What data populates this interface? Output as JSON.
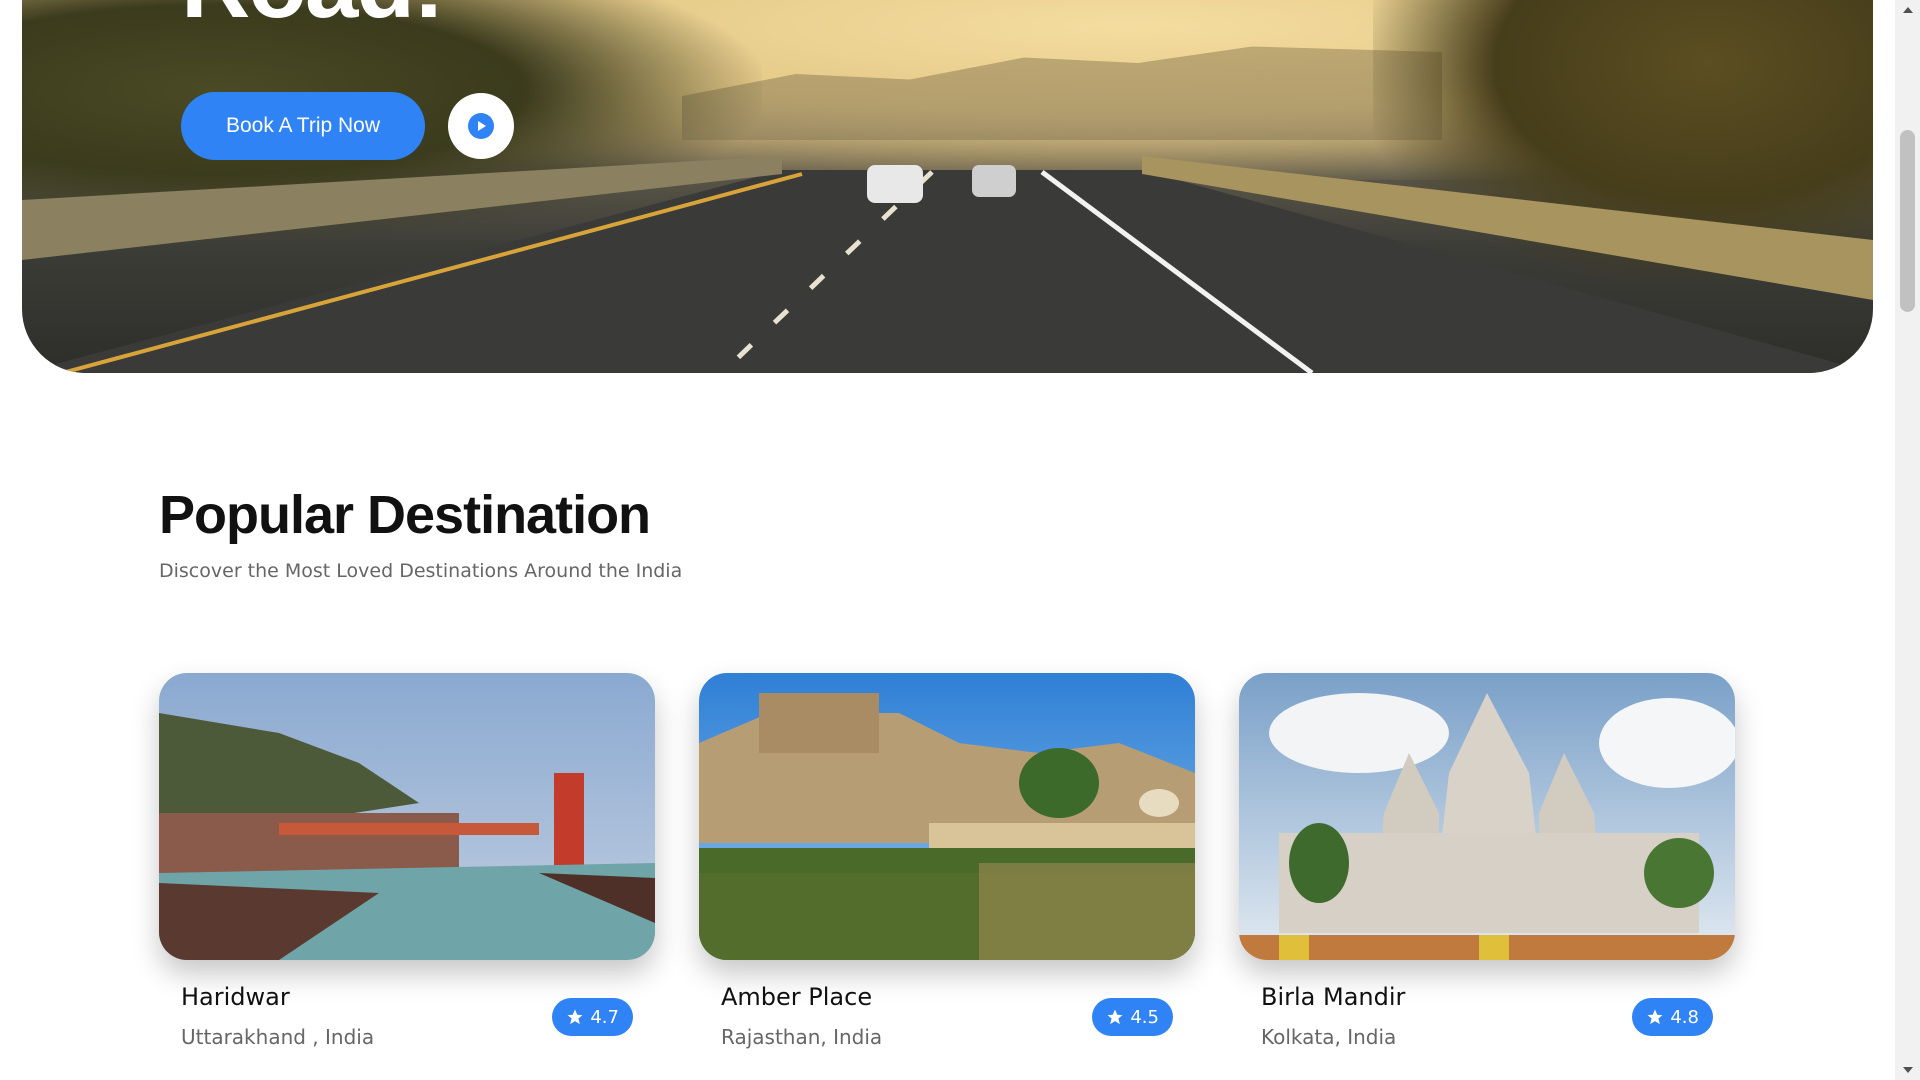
{
  "hero": {
    "title": "Road!",
    "book_button": "Book A Trip Now",
    "play_button_icon": "play-icon"
  },
  "section": {
    "title": "Popular Destination",
    "subtitle": "Discover the Most Loved Destinations Around the India"
  },
  "cards": [
    {
      "name": "Haridwar",
      "location": "Uttarakhand , India",
      "rating": "4.7"
    },
    {
      "name": "Amber Place",
      "location": "Rajasthan, India",
      "rating": "4.5"
    },
    {
      "name": "Birla Mandir",
      "location": "Kolkata, India",
      "rating": "4.8"
    }
  ],
  "colors": {
    "accent": "#2f83f5",
    "title": "#111111",
    "muted": "#666666"
  }
}
